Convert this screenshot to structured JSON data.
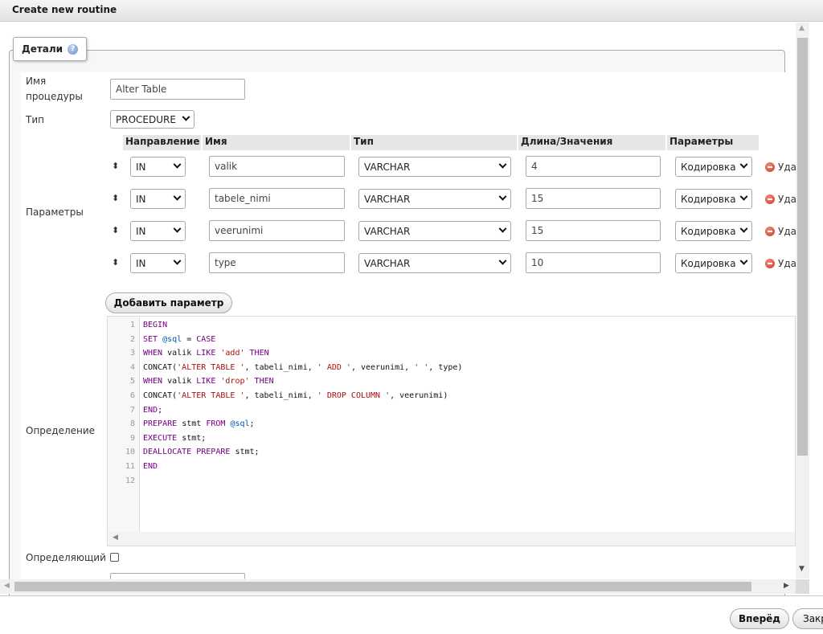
{
  "dialog": {
    "title": "Create new routine"
  },
  "legend": {
    "label": "Детали"
  },
  "form": {
    "name_label_line1": "Имя",
    "name_label_line2": "процедуры",
    "name_value": "Alter Table",
    "type_label": "Тип",
    "type_value": "PROCEDURE",
    "params_label": "Параметры",
    "definition_label": "Определение",
    "definer_label": "Определяющий"
  },
  "params_table": {
    "headers": [
      "Направление",
      "Имя",
      "Тип",
      "Длина/Значения",
      "Параметры"
    ],
    "rows": [
      {
        "direction": "IN",
        "name": "valik",
        "type": "VARCHAR",
        "length": "4",
        "options": "Кодировка",
        "delete": "Уда"
      },
      {
        "direction": "IN",
        "name": "tabele_nimi",
        "type": "VARCHAR",
        "length": "15",
        "options": "Кодировка",
        "delete": "Уда"
      },
      {
        "direction": "IN",
        "name": "veerunimi",
        "type": "VARCHAR",
        "length": "15",
        "options": "Кодировка",
        "delete": "Уда"
      },
      {
        "direction": "IN",
        "name": "type",
        "type": "VARCHAR",
        "length": "10",
        "options": "Кодировка",
        "delete": "Уда"
      }
    ],
    "add_button": "Добавить параметр"
  },
  "code": {
    "line_numbers": [
      "1",
      "2",
      "3",
      "4",
      "5",
      "6",
      "7",
      "8",
      "9",
      "10",
      "11",
      "12"
    ],
    "lines": [
      "BEGIN",
      "SET @sql = CASE",
      "WHEN valik LIKE 'add' THEN",
      "CONCAT('ALTER TABLE ', tabeli_nimi, ' ADD ', veerunimi, ' ', type)",
      "WHEN valik LIKE 'drop' THEN",
      "CONCAT('ALTER TABLE ', tabeli_nimi, ' DROP COLUMN ', veerunimi)",
      "END;",
      "PREPARE stmt FROM @sql;",
      "EXECUTE stmt;",
      "DEALLOCATE PREPARE stmt;",
      "END",
      ""
    ]
  },
  "footer": {
    "go_button": "Вперёд",
    "close_button": "Закр"
  },
  "icons": {
    "help": "help-icon",
    "delete": "delete-icon",
    "drag": "drag-handle-icon",
    "chevron": "chevron-down-icon",
    "scroll_up": "arrow-up-icon",
    "scroll_down": "arrow-down-icon",
    "scroll_left": "arrow-left-icon",
    "scroll_right": "arrow-right-icon"
  },
  "colors": {
    "delete_icon": "#d0392a",
    "help_icon": "#6b8fc7",
    "keyword": "#770088",
    "string": "#aa1111"
  }
}
